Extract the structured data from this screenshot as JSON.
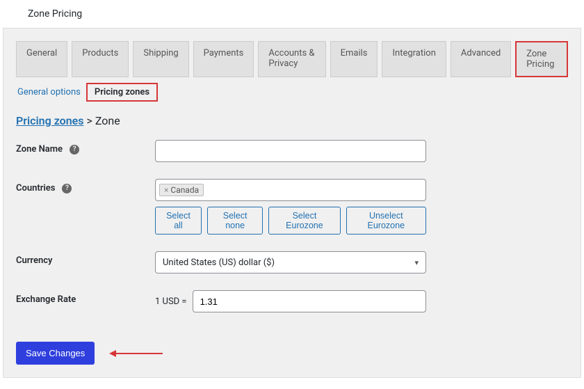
{
  "header": {
    "title": "Zone Pricing"
  },
  "tabs": [
    {
      "label": "General"
    },
    {
      "label": "Products"
    },
    {
      "label": "Shipping"
    },
    {
      "label": "Payments"
    },
    {
      "label": "Accounts & Privacy"
    },
    {
      "label": "Emails"
    },
    {
      "label": "Integration"
    },
    {
      "label": "Advanced"
    },
    {
      "label": "Zone Pricing"
    }
  ],
  "subtabs": {
    "general_options": "General options",
    "pricing_zones": "Pricing zones"
  },
  "breadcrumb": {
    "link": "Pricing zones",
    "sep": " > ",
    "current": "Zone"
  },
  "form": {
    "zone_name": {
      "label": "Zone Name",
      "value": ""
    },
    "countries": {
      "label": "Countries",
      "chips": [
        {
          "label": "Canada"
        }
      ],
      "buttons": {
        "select_all": "Select all",
        "select_none": "Select none",
        "select_eurozone": "Select Eurozone",
        "unselect_eurozone": "Unselect Eurozone"
      }
    },
    "currency": {
      "label": "Currency",
      "selected": "United States (US) dollar ($)"
    },
    "exchange_rate": {
      "label": "Exchange Rate",
      "prefix": "1 USD =",
      "value": "1.31"
    }
  },
  "actions": {
    "save": "Save Changes"
  }
}
